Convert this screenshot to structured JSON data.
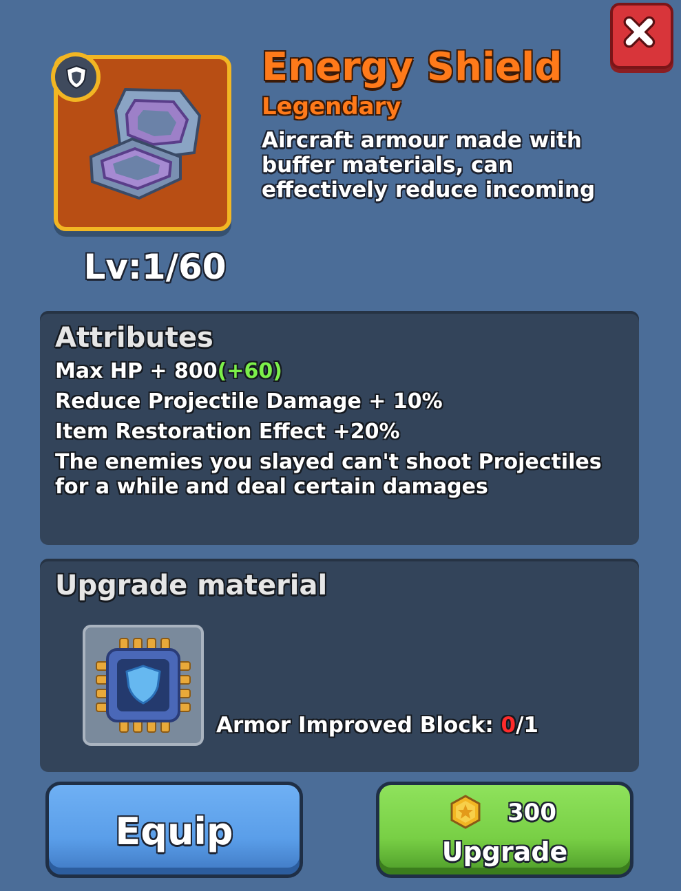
{
  "item": {
    "name": "Energy Shield",
    "rarity": "Legendary",
    "description_lines": [
      "Aircraft armour made with",
      "buffer materials, can",
      "effectively reduce incoming"
    ],
    "level": "Lv:1/60",
    "icon": "shield-armor-icon",
    "badge_icon": "shield-badge-icon"
  },
  "attributes": {
    "title": "Attributes",
    "hp_base": "Max HP + 800",
    "hp_bonus": "(+60)",
    "line2": "Reduce Projectile Damage + 10%",
    "line3": "Item Restoration Effect +20%",
    "line4": "The enemies you slayed can't shoot Projectiles for a while and deal certain damages"
  },
  "upgrade_material": {
    "title": "Upgrade material",
    "label": "Armor Improved Block: ",
    "owned": "0",
    "required": "/1",
    "icon": "armor-block-chip-icon"
  },
  "buttons": {
    "equip": "Equip",
    "upgrade": "Upgrade",
    "upgrade_cost": "300",
    "close_icon": "close-icon",
    "coin_icon": "gold-coin-icon"
  },
  "colors": {
    "background": "#4b6d98",
    "rarity_orange": "#ff7a1a",
    "bonus_green": "#7cf04a",
    "missing_red": "#ff2b2b",
    "equip_blue": "#5a9ee9",
    "upgrade_green": "#78cf45"
  }
}
